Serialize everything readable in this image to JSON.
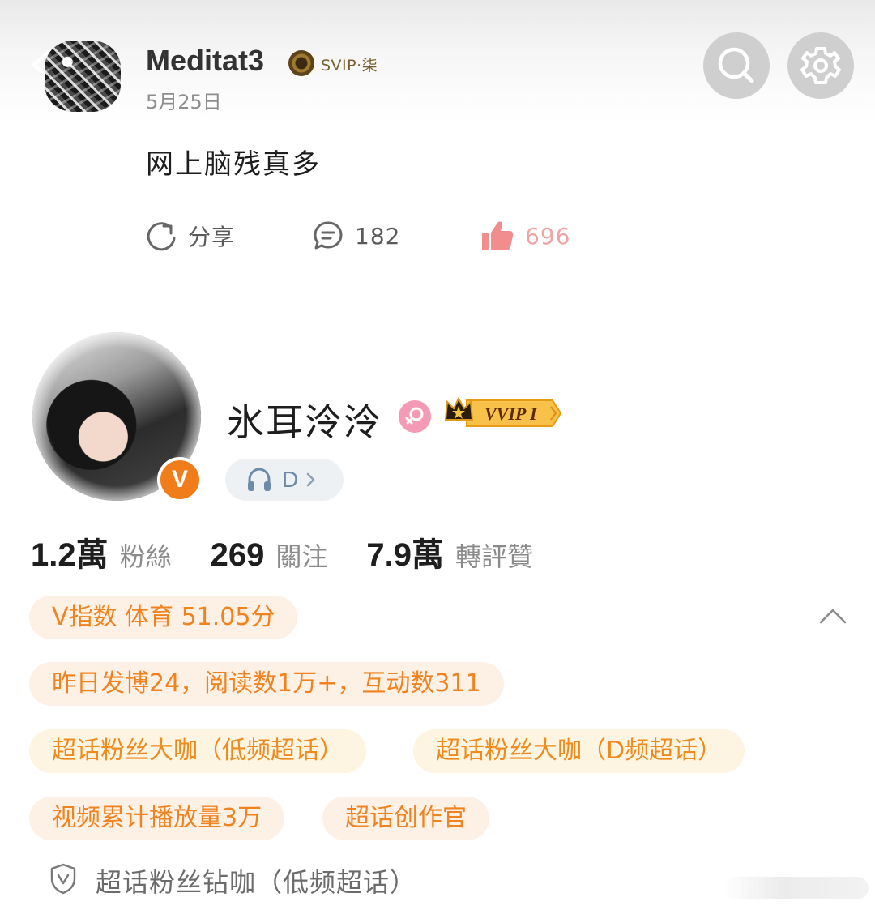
{
  "post": {
    "author": "Meditat3",
    "vip_label": "SVIP·柒",
    "date": "5月25日",
    "text": "网上脑残真多",
    "share_label": "分享",
    "comment_count": "182",
    "like_count": "696"
  },
  "profile": {
    "name": "氷耳泠泠",
    "vvip_label": "VVIP I",
    "d_label": "D",
    "stats": [
      {
        "value": "1.2萬",
        "label": "粉絲"
      },
      {
        "value": "269",
        "label": "關注"
      },
      {
        "value": "7.9萬",
        "label": "轉評贊"
      }
    ]
  },
  "tags": {
    "v_index": "V指数 体育 51.05分",
    "yesterday": "昨日发博24，阅读数1万+，互动数311",
    "fan1": "超话粉丝大咖（低频超话）",
    "fan2": "超话粉丝大咖（D频超话）",
    "video": "视频累计播放量3万",
    "creator": "超话创作官"
  },
  "bottom_badge": "超话粉丝钻咖（低频超话）",
  "colors": {
    "accent": "#f0831f",
    "tag_bg": "#fdf1e6",
    "like": "#f0a3a3",
    "v_badge": "#f07d1a"
  }
}
